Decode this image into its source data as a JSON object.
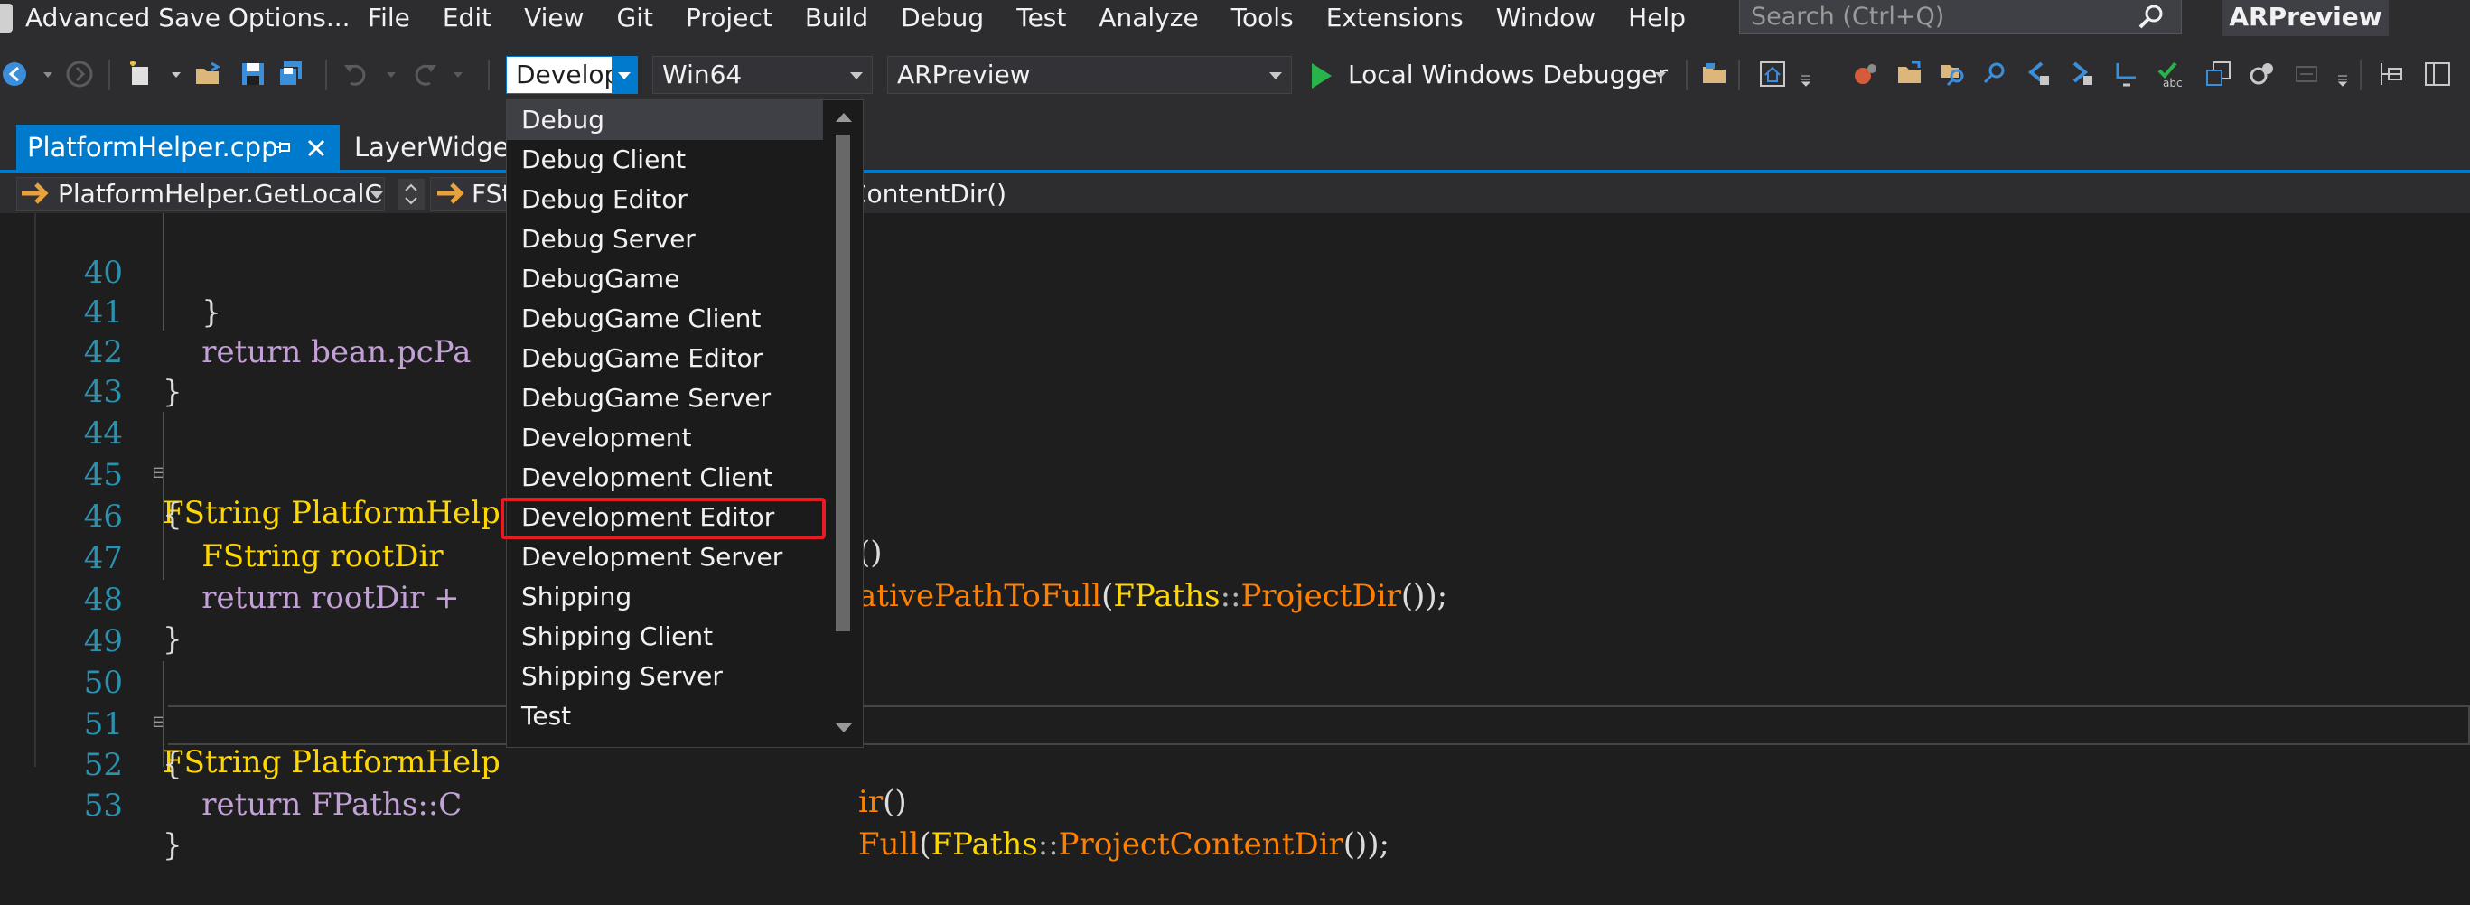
{
  "window": {
    "file_title": "Advanced Save Options...",
    "menu": [
      "File",
      "Edit",
      "View",
      "Git",
      "Project",
      "Build",
      "Debug",
      "Test",
      "Analyze",
      "Tools",
      "Extensions",
      "Window",
      "Help"
    ],
    "search_placeholder": "Search (Ctrl+Q)",
    "project_name": "ARPreview"
  },
  "toolbar": {
    "config_value": "Development Editor",
    "config_visible": "Develop",
    "platform_value": "Win64",
    "startup_project_value": "ARPreview",
    "debugger_label": "Local Windows Debugger"
  },
  "tabs": [
    {
      "label": "PlatformHelper.cpp",
      "active": true
    },
    {
      "label": "LayerWidget.",
      "active": false
    }
  ],
  "nav": {
    "scope": "PlatformHelper.GetLocalC",
    "member": "FSt",
    "function": "ContentDir()"
  },
  "config_dropdown": {
    "options": [
      "Debug",
      "Debug Client",
      "Debug Editor",
      "Debug Server",
      "DebugGame",
      "DebugGame Client",
      "DebugGame Editor",
      "DebugGame Server",
      "Development",
      "Development Client",
      "Development Editor",
      "Development Server",
      "Shipping",
      "Shipping Client",
      "Shipping Server",
      "Test"
    ],
    "hovered": "Debug",
    "highlighted": "Development Editor",
    "highlight_color": "#e51c23"
  },
  "code": {
    "lines": [
      {
        "n": "40",
        "t": "    }"
      },
      {
        "n": "41",
        "t": "    return bean.pcPa"
      },
      {
        "n": "42",
        "t": "}"
      },
      {
        "n": "43",
        "t": ""
      },
      {
        "n": "44",
        "t": "FString PlatformHelp"
      },
      {
        "n": "45",
        "t": "{"
      },
      {
        "n": "46",
        "t": "    FString rootDir"
      },
      {
        "n": "47",
        "t": "    return rootDir +"
      },
      {
        "n": "48",
        "t": "}"
      },
      {
        "n": "49",
        "t": ""
      },
      {
        "n": "50",
        "t": "FString PlatformHelp"
      },
      {
        "n": "51",
        "t": "{"
      },
      {
        "n": "52",
        "t": "    return FPaths::C"
      },
      {
        "n": "53",
        "t": "}"
      }
    ],
    "right_44": "()",
    "right_46a": "ativePathToFull",
    "right_46b": "(",
    "right_46c": "FPaths",
    "right_46d": "::",
    "right_46e": "ProjectDir",
    "right_46f": "());",
    "right_50a": "ir",
    "right_50b": "()",
    "right_52a": "Full",
    "right_52b": "(",
    "right_52c": "FPaths",
    "right_52d": "::",
    "right_52e": "ProjectContentDir",
    "right_52f": "());"
  },
  "colors": {
    "accent": "#007acc",
    "line_number": "#2b91af",
    "keyword_type": "#ffd700",
    "function": "#ff8000",
    "variable": "#c3a0d8"
  }
}
